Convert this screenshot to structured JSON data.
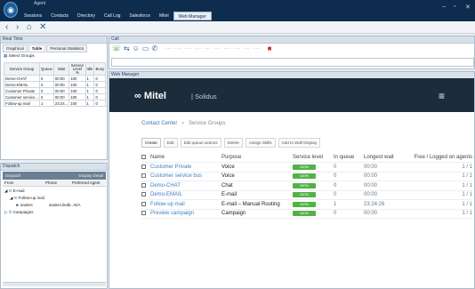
{
  "titlebar": {
    "app_title": "Agent",
    "menus": [
      "Sessions",
      "Contacts",
      "Directory",
      "Call Log",
      "Salesforce",
      "Mitel",
      "Web Manager"
    ],
    "active_menu": "Web Manager",
    "win_controls": [
      "–",
      "▫",
      "✕"
    ]
  },
  "toolbar": {
    "icons": [
      "‹",
      "›",
      "⌂",
      "✕"
    ]
  },
  "realtime": {
    "title": "Real Time",
    "tabs": [
      "Graphical",
      "Table",
      "Personal Statistics"
    ],
    "active_tab": "Table",
    "select_groups": "Select Groups",
    "columns": [
      "Service Group",
      "Queue",
      "Wait",
      "Service Level %",
      "Idle",
      "Busy"
    ],
    "rows": [
      [
        "Demo-CHAT",
        "0",
        "00:00",
        "100",
        "1",
        "0"
      ],
      [
        "Demo-EMAIL",
        "0",
        "00:00",
        "100",
        "1",
        "0"
      ],
      [
        "Customer Private",
        "0",
        "00:00",
        "100",
        "1",
        "0"
      ],
      [
        "Customer service...",
        "0",
        "00:00",
        "100",
        "1",
        "0"
      ],
      [
        "Follow-up mail",
        "1",
        "23:24...",
        "100",
        "1",
        "0"
      ]
    ]
  },
  "dispatch": {
    "title": "Dispatch",
    "bar_left": "Dispatch",
    "bar_right": "Display Detail",
    "columns": [
      "From",
      "Phone",
      "Preferred Agent"
    ],
    "tree": {
      "email": "E-mail",
      "followup": "Follow-up mail",
      "anders": "anders",
      "anders_phone": "anders.lindb...",
      "anders_pref": "N/A",
      "campaigns": "Campaigns"
    }
  },
  "call": {
    "title": "Call"
  },
  "webmanager": {
    "title": "Web Manager",
    "brand": "Mitel",
    "product": "Solidus",
    "breadcrumb": [
      "Contact Center",
      "Service Groups"
    ],
    "actions": [
      "Create",
      "Edit",
      "Edit queue actions",
      "Delete",
      "Assign Skills",
      "Add to Wall Display"
    ],
    "columns": [
      "Name",
      "Purpose",
      "Service level",
      "In queue",
      "Longest wait",
      "Free / Logged on agents"
    ],
    "rows": [
      {
        "name": "Customer Private",
        "purpose": "Voice",
        "sl": "100%",
        "queue": "0",
        "wait": "00:00",
        "agents": "1 / 1"
      },
      {
        "name": "Customer service bus",
        "purpose": "Voice",
        "sl": "100%",
        "queue": "0",
        "wait": "00:00",
        "agents": "1 / 1"
      },
      {
        "name": "Demo-CHAT",
        "purpose": "Chat",
        "sl": "100%",
        "queue": "0",
        "wait": "00:00",
        "agents": "1 / 1"
      },
      {
        "name": "Demo-EMAIL",
        "purpose": "E-mail",
        "sl": "100%",
        "queue": "0",
        "wait": "00:00",
        "agents": "1 / 1"
      },
      {
        "name": "Follow-up mail",
        "purpose": "E-mail – Manual Routing",
        "sl": "100%",
        "queue": "1",
        "wait": "23:24:26",
        "agents": "1 / 1"
      },
      {
        "name": "Preview campaign",
        "purpose": "Campaign",
        "sl": "100%",
        "queue": "0",
        "wait": "00:00",
        "agents": "1 / 1"
      }
    ]
  },
  "colors": {
    "titlebar": "#0e2d4e",
    "mitel_bar": "#1c2c3b",
    "service_ok": "#52b246",
    "link": "#3f7fc3"
  }
}
